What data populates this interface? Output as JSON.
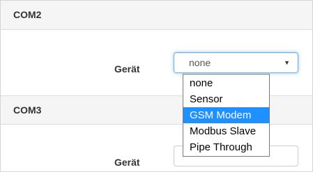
{
  "com2": {
    "title": "COM2",
    "device_label": "Gerät",
    "device_select": {
      "value": "none",
      "arrow": "▼",
      "options": [
        "none",
        "Sensor",
        "GSM Modem",
        "Modbus Slave",
        "Pipe Through"
      ],
      "highlighted": "GSM Modem"
    }
  },
  "com3": {
    "title": "COM3",
    "device_label": "Gerät"
  },
  "colors": {
    "highlight": "#1e90ff",
    "header_bg": "#f5f5f5",
    "focus_border": "#66afe9"
  }
}
